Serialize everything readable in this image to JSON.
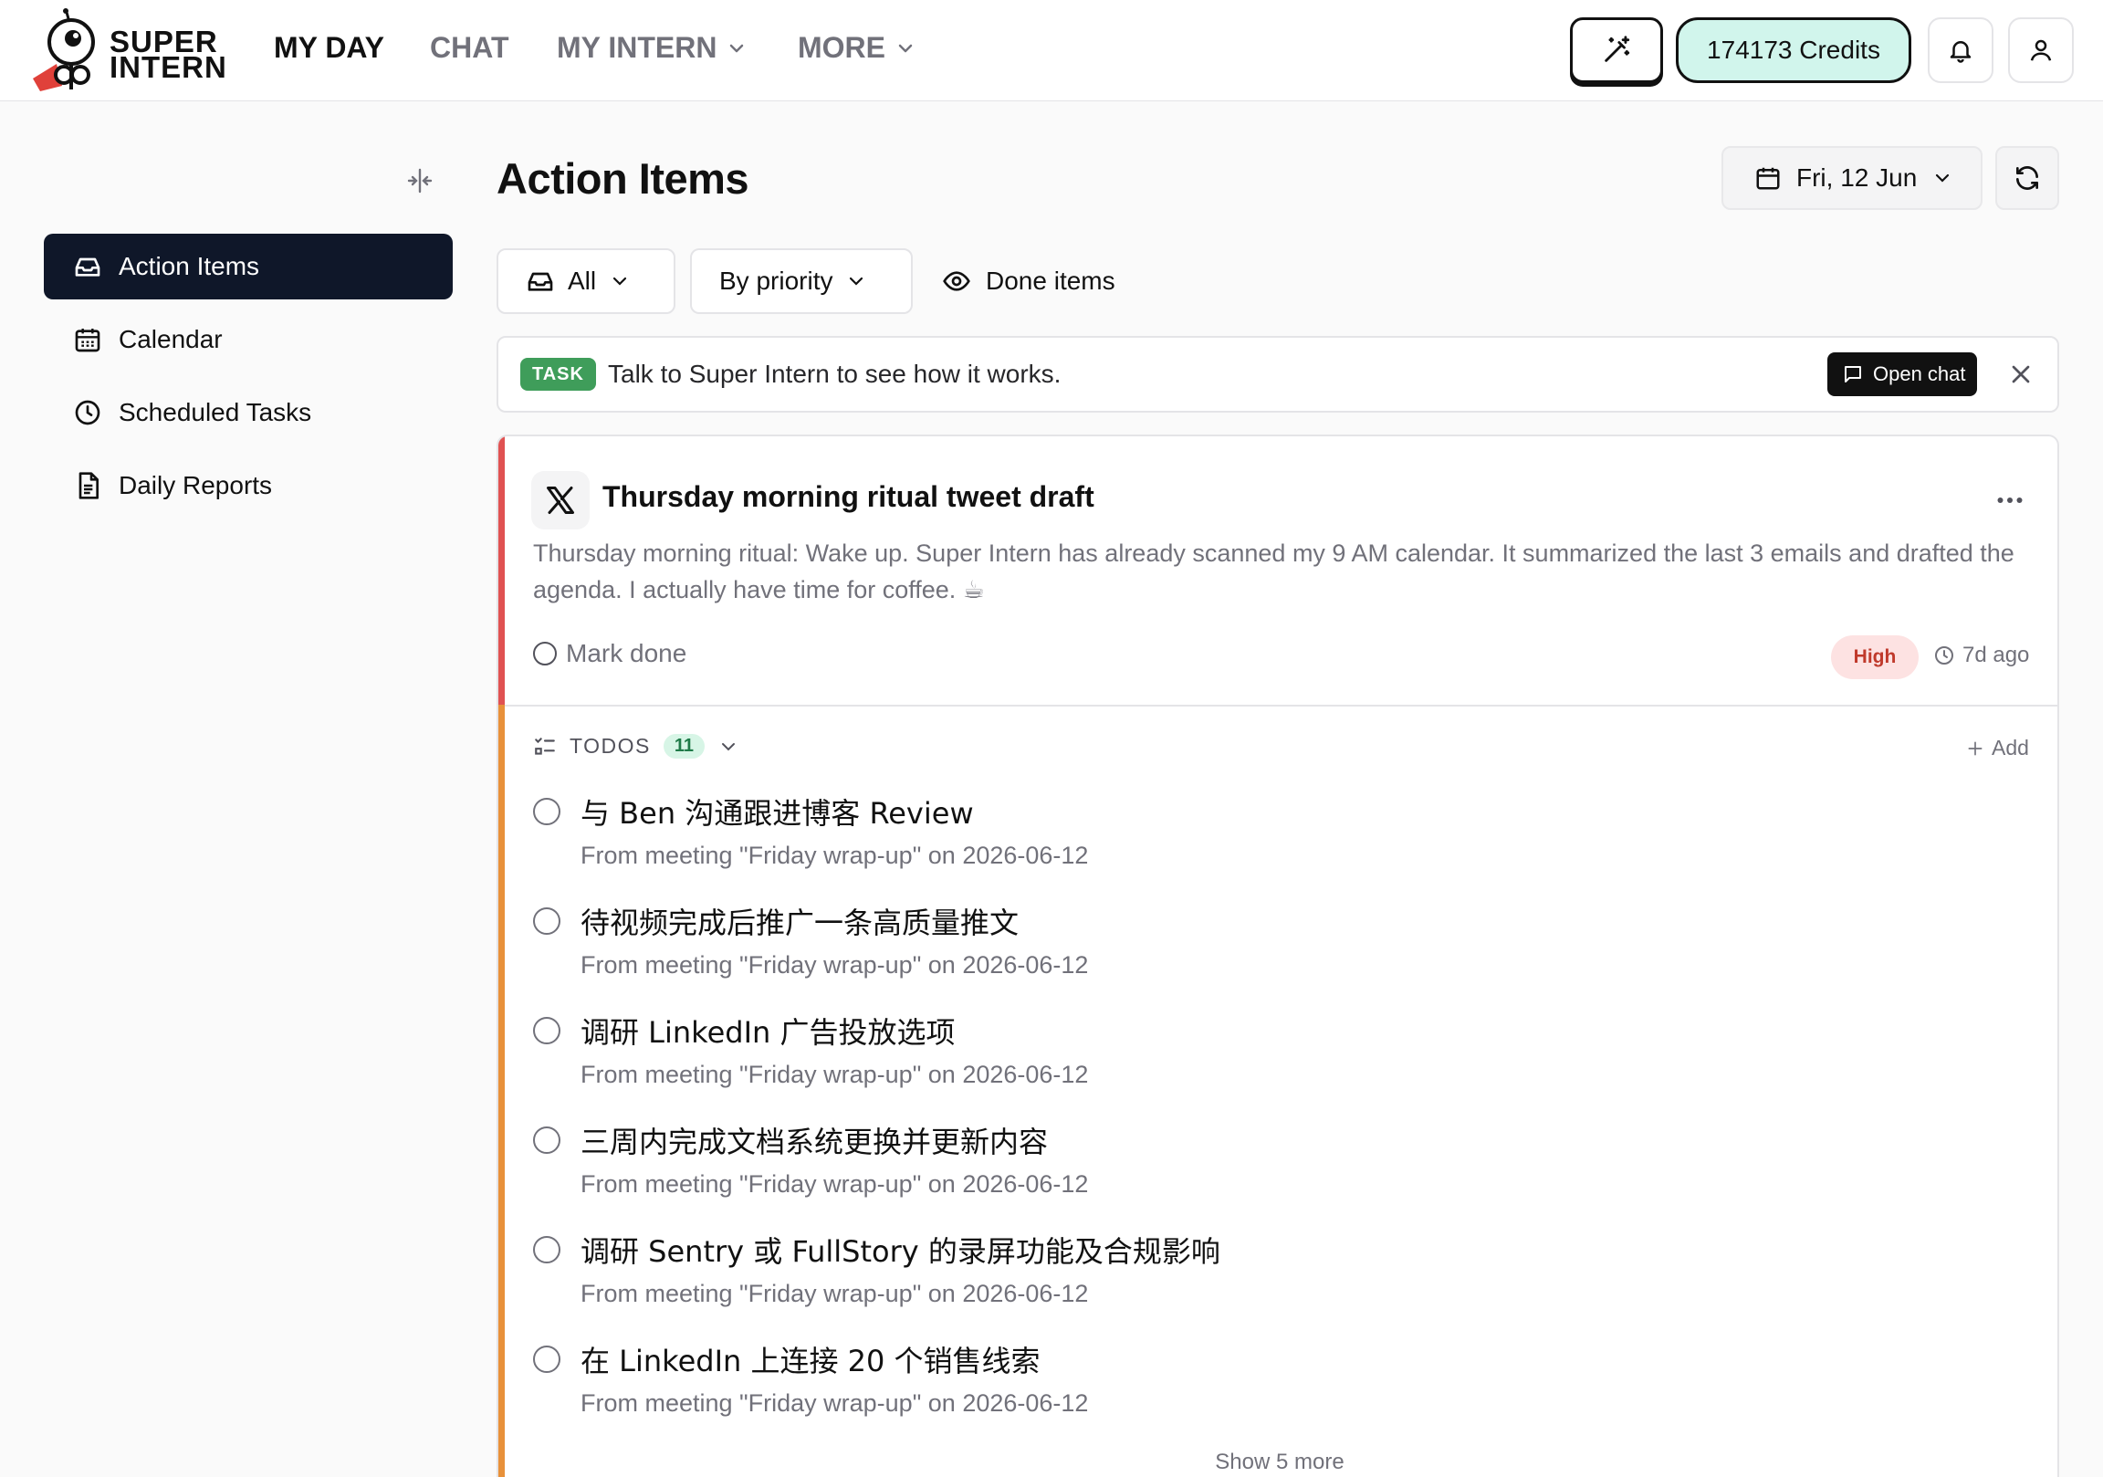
{
  "header": {
    "brand_line1": "SUPER",
    "brand_line2": "INTERN",
    "nav": [
      {
        "label": "MY DAY",
        "active": true
      },
      {
        "label": "CHAT"
      },
      {
        "label": "MY INTERN"
      },
      {
        "label": "MORE"
      }
    ],
    "credits": "174173 Credits"
  },
  "sidebar": {
    "items": [
      {
        "label": "Action Items",
        "icon": "inbox-icon",
        "active": true
      },
      {
        "label": "Calendar",
        "icon": "calendar-icon"
      },
      {
        "label": "Scheduled Tasks",
        "icon": "clock-icon"
      },
      {
        "label": "Daily Reports",
        "icon": "document-icon"
      }
    ]
  },
  "main": {
    "title": "Action Items",
    "date": "Fri, 12 Jun",
    "filters": {
      "scope": "All",
      "sort": "By priority",
      "done_items": "Done items"
    },
    "banner": {
      "tag": "TASK",
      "text": "Talk to Super Intern to see how it works.",
      "button": "Open chat"
    },
    "card": {
      "title": "Thursday morning ritual tweet draft",
      "description": "Thursday morning ritual: Wake up. Super Intern has already scanned my 9 AM calendar. It summarized the last 3 emails and drafted the agenda. I actually have time for coffee. ☕",
      "mark_done": "Mark done",
      "priority": "High",
      "age": "7d ago",
      "todos_label": "TODOS",
      "todos_count": "11",
      "add_label": "Add",
      "todos": [
        {
          "title": "与 Ben 沟通跟进博客 Review",
          "source": "From meeting \"Friday wrap-up\" on 2026-06-12"
        },
        {
          "title": "待视频完成后推广一条高质量推文",
          "source": "From meeting \"Friday wrap-up\" on 2026-06-12"
        },
        {
          "title": "调研 LinkedIn 广告投放选项",
          "source": "From meeting \"Friday wrap-up\" on 2026-06-12"
        },
        {
          "title": "三周内完成文档系统更换并更新内容",
          "source": "From meeting \"Friday wrap-up\" on 2026-06-12"
        },
        {
          "title": "调研 Sentry 或 FullStory 的录屏功能及合规影响",
          "source": "From meeting \"Friday wrap-up\" on 2026-06-12"
        },
        {
          "title": "在 LinkedIn 上连接 20 个销售线索",
          "source": "From meeting \"Friday wrap-up\" on 2026-06-12"
        }
      ],
      "show_more": "Show 5 more"
    }
  },
  "colors": {
    "accent_dark": "#0f1729",
    "credits_bg": "#d1f5ec",
    "priority_high": "#e05252",
    "todo_accent": "#e8913a",
    "tag_green": "#3f9d5a"
  }
}
